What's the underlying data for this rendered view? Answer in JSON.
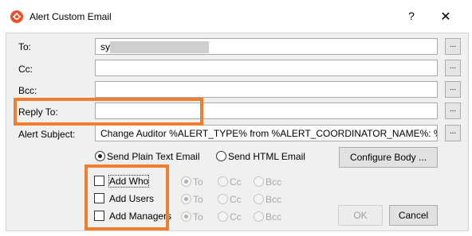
{
  "window": {
    "title": "Alert Custom Email",
    "help_label": "?",
    "close_label": "✕",
    "accent": "#ef7f2e"
  },
  "fields": {
    "to": {
      "label": "To:",
      "value": "sy"
    },
    "cc": {
      "label": "Cc:",
      "value": ""
    },
    "bcc": {
      "label": "Bcc:",
      "value": ""
    },
    "reply_to": {
      "label": "Reply To:",
      "value": ""
    },
    "alert_subject": {
      "label": "Alert Subject:",
      "value": "Change Auditor %ALERT_TYPE% from %ALERT_COORDINATOR_NAME%: %ALER"
    },
    "ellipsis_label": "..."
  },
  "format": {
    "plain_label": "Send Plain Text Email",
    "html_label": "Send HTML Email",
    "selected": "plain",
    "configure_body_label": "Configure Body ..."
  },
  "recipients": [
    {
      "label": "Add Who",
      "checked": false,
      "focused": true
    },
    {
      "label": "Add Users",
      "checked": false,
      "focused": false
    },
    {
      "label": "Add Managers",
      "checked": false,
      "focused": false
    }
  ],
  "recipient_options": {
    "to": "To",
    "cc": "Cc",
    "bcc": "Bcc",
    "selected": "To",
    "disabled": true
  },
  "buttons": {
    "ok_label": "OK",
    "cancel_label": "Cancel"
  }
}
